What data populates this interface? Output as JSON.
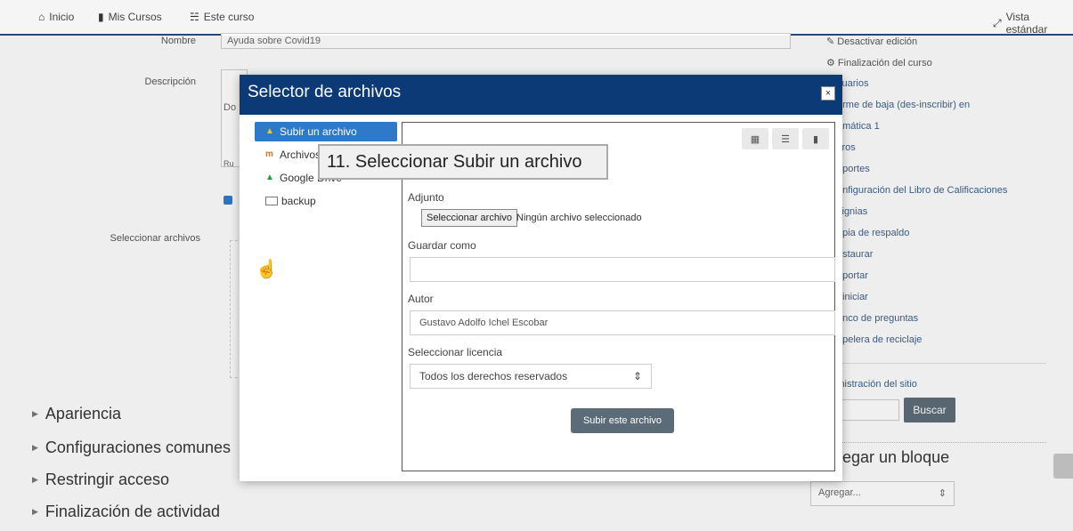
{
  "topbar": {
    "home": "Inicio",
    "courses": "Mis Cursos",
    "this_course": "Este curso",
    "view": "Vista estándar"
  },
  "background_form": {
    "name_label": "Nombre",
    "name_value": "Ayuda sobre Covid19",
    "description_label": "Descripción",
    "description_partial": "Do",
    "path_partial": "Ru",
    "select_files_label": "Seleccionar archivos",
    "sections": [
      "Apariencia",
      "Configuraciones comunes",
      "Restringir acceso",
      "Finalización de actividad"
    ]
  },
  "admin_sidebar": {
    "items": [
      "Desactivar edición",
      "Finalización del curso",
      "suarios",
      "arme de baja (des-inscribir) en",
      "emática 1",
      "ltros",
      "eportes",
      "onfiguración del Libro de Calificaciones",
      "signias",
      "opia de respaldo",
      "estaurar",
      "nportar",
      "einiciar",
      "anco de preguntas",
      "apelera de reciclaje",
      "inistración del sitio"
    ],
    "search_button": "Buscar",
    "add_block_title": "regar un bloque",
    "add_block_select": "Agregar..."
  },
  "modal": {
    "title": "Selector de archivos",
    "close": "×",
    "repositories": [
      {
        "label": "Subir un archivo",
        "icon": "upload-icon"
      },
      {
        "label": "Archivos",
        "icon": "moodle-icon"
      },
      {
        "label": "Google Drive",
        "icon": "google-drive-icon"
      },
      {
        "label": "backup",
        "icon": "folder-icon"
      }
    ],
    "attachment_label": "Adjunto",
    "choose_file_button": "Seleccionar archivo",
    "no_file": "Ningún archivo seleccionado",
    "save_as_label": "Guardar como",
    "save_as_value": "",
    "author_label": "Autor",
    "author_value": "Gustavo Adolfo Ichel Escobar",
    "licence_label": "Seleccionar licencia",
    "licence_value": "Todos los derechos reservados",
    "upload_button": "Subir este archivo"
  },
  "annotation": {
    "text": "11. Seleccionar Subir un archivo"
  }
}
